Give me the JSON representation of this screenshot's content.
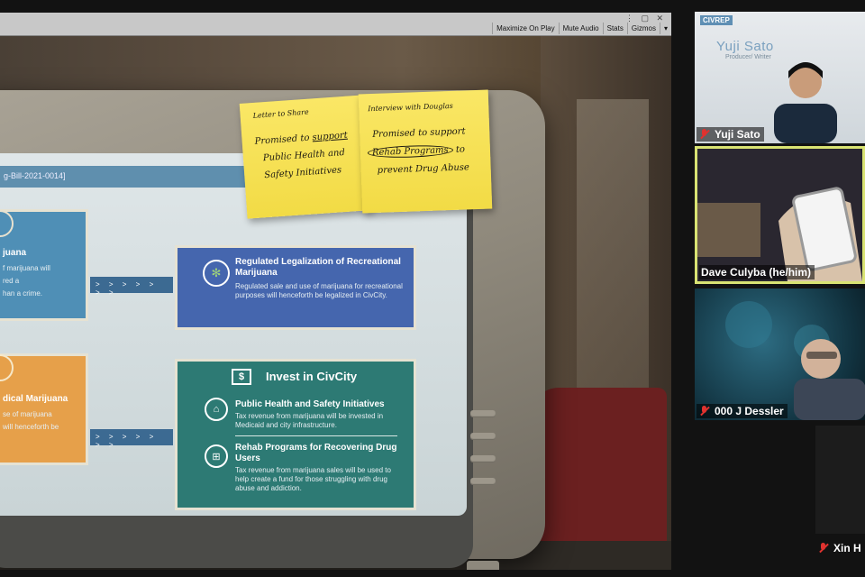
{
  "unity_toolbar": {
    "buttons": [
      "Maximize On Play",
      "Mute Audio",
      "Stats",
      "Gizmos"
    ]
  },
  "screen": {
    "header_id": "g-Bill-2021-0014]",
    "left_cards": {
      "blue_title": "juana",
      "blue_text_1": "f marijuana will",
      "blue_text_2": "red a",
      "blue_text_3": "han a crime.",
      "orange_title": "dical Marijuana",
      "orange_text_1": "se of marijuana",
      "orange_text_2": "will henceforth be"
    },
    "arrow_text": "> > > > > > >",
    "legalization": {
      "title": "Regulated Legalization of Recreational Marijuana",
      "text": "Regulated sale and use of marijuana for recreational purposes will henceforth be legalized in CivCity."
    },
    "chevron": "v v",
    "invest": {
      "title": "Invest in CivCity",
      "item1_title": "Public Health and Safety Initiatives",
      "item1_text": "Tax revenue from marijuana will be invested in Medicaid and city infrastructure.",
      "item2_title": "Rehab Programs for Recovering Drug Users",
      "item2_text": "Tax revenue from marijuana sales will be used to help create a fund for those struggling with drug abuse and addiction."
    }
  },
  "sticky_notes": [
    {
      "heading": "Letter to Share",
      "line1_a": "Promised to ",
      "line1_b": "support",
      "line2": "Public Health and",
      "line3": "Safety Initiatives"
    },
    {
      "heading": "Interview with Douglas",
      "line1": "Promised to support",
      "line2_circled": "Rehab Programs",
      "line2_rest": " to",
      "line3": "prevent Drug Abuse"
    }
  ],
  "participants": [
    {
      "name": "Yuji Sato",
      "mic_muted": true,
      "brand": "CIVREP",
      "lower_third_name": "Yuji Sato",
      "lower_third_role": "Producer/ Writer"
    },
    {
      "name": "Dave Culyba (he/him)",
      "mic_muted": false,
      "active_speaker": true
    },
    {
      "name": "000 J Dessler",
      "mic_muted": true
    },
    {
      "name": "Xin H",
      "mic_muted": true
    }
  ],
  "colors": {
    "active_speaker_border": "#d9e373",
    "muted_mic": "#e0322f",
    "card_blue": "#4566ae",
    "card_teal": "#2d7a74",
    "card_orange": "#e6a04a",
    "sticky_yellow": "#f6e154"
  }
}
